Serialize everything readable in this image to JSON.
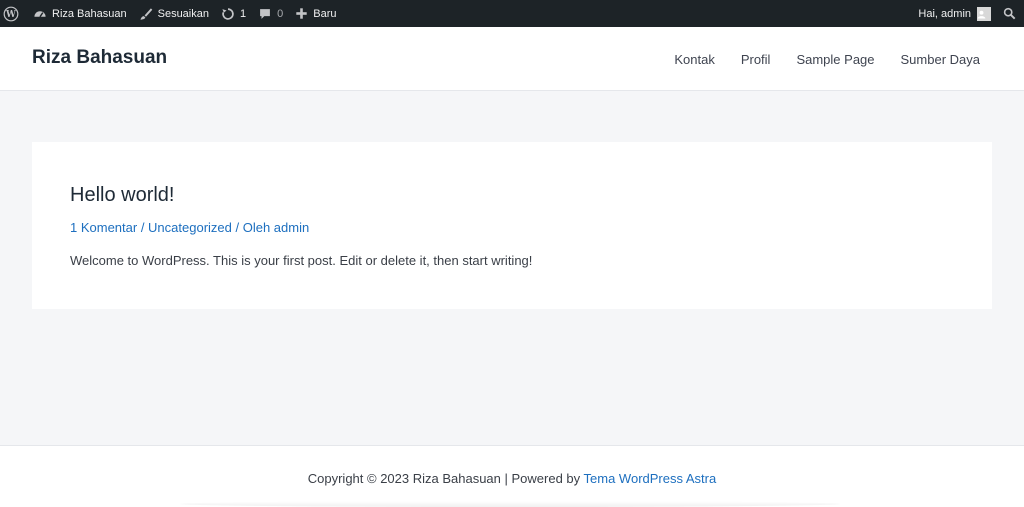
{
  "adminbar": {
    "site_name": "Riza Bahasuan",
    "customize": "Sesuaikan",
    "updates_count": "1",
    "comments_count": "0",
    "new": "Baru",
    "greeting": "Hai, admin"
  },
  "header": {
    "site_title": "Riza Bahasuan",
    "nav": [
      "Kontak",
      "Profil",
      "Sample Page",
      "Sumber Daya"
    ]
  },
  "post": {
    "title": "Hello world!",
    "meta_comments": "1 Komentar",
    "meta_sep1": " / ",
    "meta_category": "Uncategorized",
    "meta_sep2": " / ",
    "meta_author": "Oleh admin",
    "excerpt": "Welcome to WordPress. This is your first post. Edit or delete it, then start writing!"
  },
  "footer": {
    "copyright_text": "Copyright © 2023 Riza Bahasuan | Powered by ",
    "theme_link": "Tema WordPress Astra"
  },
  "colors": {
    "adminbar_bg": "#1d2327",
    "link": "#1d6fbf",
    "page_bg": "#f5f6f8"
  }
}
